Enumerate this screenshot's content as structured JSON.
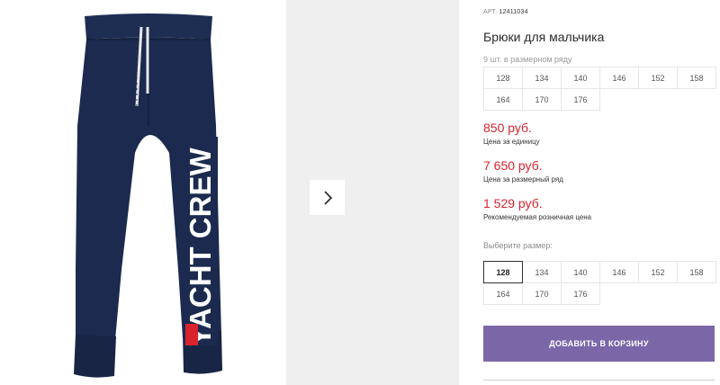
{
  "product": {
    "art_label": "АРТ.",
    "art_number": "12411034",
    "title": "Брюки для мальчика",
    "brand_print": "YACHT CREW",
    "row_caption": "9 шт. в размерном ряду",
    "row_sizes": [
      "128",
      "134",
      "140",
      "146",
      "152",
      "158",
      "164",
      "170",
      "176"
    ]
  },
  "prices": {
    "unit_price": "850 руб.",
    "unit_label": "Цена за единицу",
    "row_price": "7 650 руб.",
    "row_label": "Цена за размерный ряд",
    "retail_price": "1 529 руб.",
    "retail_label": "Рекомендуемая розничная цена"
  },
  "size_picker": {
    "label": "Выберите размер:",
    "sizes": [
      "128",
      "134",
      "140",
      "146",
      "152",
      "158",
      "164",
      "170",
      "176"
    ],
    "selected": "128"
  },
  "cart": {
    "add_label": "Добавить в корзину"
  },
  "colors": {
    "price": "#d9232d",
    "button": "#7b66a8",
    "pants": "#1b2a4e"
  },
  "icons": {
    "next": "chevron-right-icon"
  }
}
